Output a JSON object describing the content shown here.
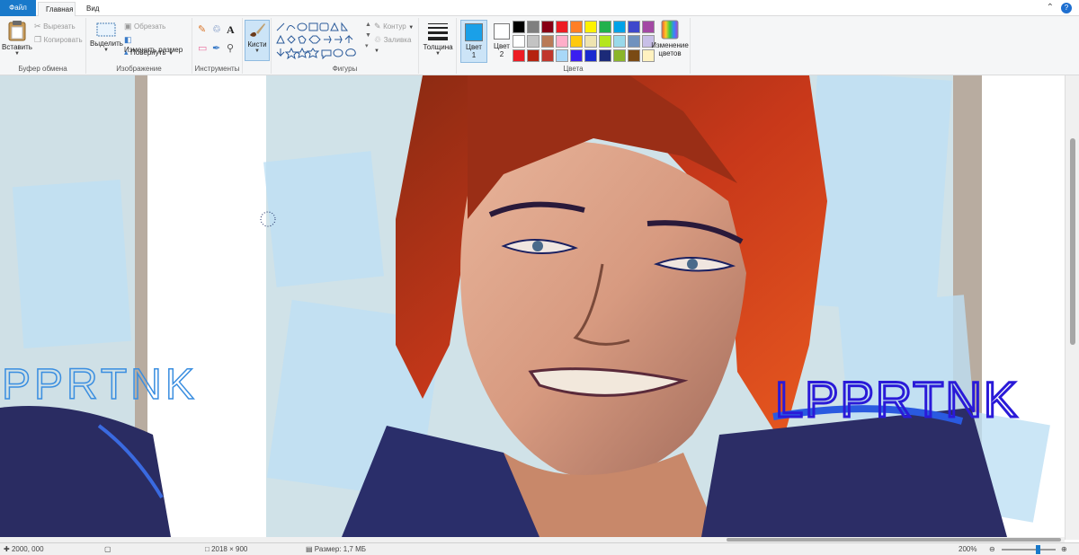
{
  "tabs": {
    "file": "Файл",
    "home": "Главная",
    "view": "Вид"
  },
  "clipboard": {
    "paste": "Вставить",
    "cut": "Вырезать",
    "copy": "Копировать",
    "label": "Буфер обмена"
  },
  "image": {
    "select": "Выделить",
    "crop": "Обрезать",
    "resize": "Изменить размер",
    "rotate": "Повернуть",
    "label": "Изображение"
  },
  "tools": {
    "label": "Инструменты"
  },
  "brushes": {
    "label": "Кисти"
  },
  "shapes": {
    "outline": "Контур",
    "fill": "Заливка",
    "label": "Фигуры"
  },
  "size": {
    "label": "Толщина"
  },
  "colors": {
    "color1": "Цвет",
    "color1_num": "1",
    "color2": "Цвет",
    "color2_num": "2",
    "edit": "Изменение цветов",
    "label": "Цвета",
    "color1_value": "#1aa0e8",
    "color2_value": "#ffffff",
    "palette_row1": [
      "#000000",
      "#7f7f7f",
      "#880015",
      "#ed1c24",
      "#ff7f27",
      "#fff200",
      "#22b14c",
      "#00a2e8",
      "#3f48cc",
      "#a349a4"
    ],
    "palette_row2": [
      "#ffffff",
      "#c3c3c3",
      "#b97a57",
      "#ffaec9",
      "#ffc90e",
      "#efe4b0",
      "#b5e61d",
      "#99d9ea",
      "#7092be",
      "#c8bfe7"
    ],
    "palette_row3": [
      "#ed1c24",
      "#b5230f",
      "#c0362c",
      "#a8d8f8",
      "#3a1ef0",
      "#1a2ad0",
      "#1c2a78",
      "#8bb52a",
      "#7a4a14",
      "#fff2c0"
    ]
  },
  "canvas": {
    "signature_left": "PPRTNK",
    "signature_right": "LPPRTNK"
  },
  "status": {
    "cursor": "2000, 000",
    "selection": "",
    "size": "2018 × 900",
    "file_size": "Размер: 1,7 МБ",
    "zoom": "200%"
  }
}
